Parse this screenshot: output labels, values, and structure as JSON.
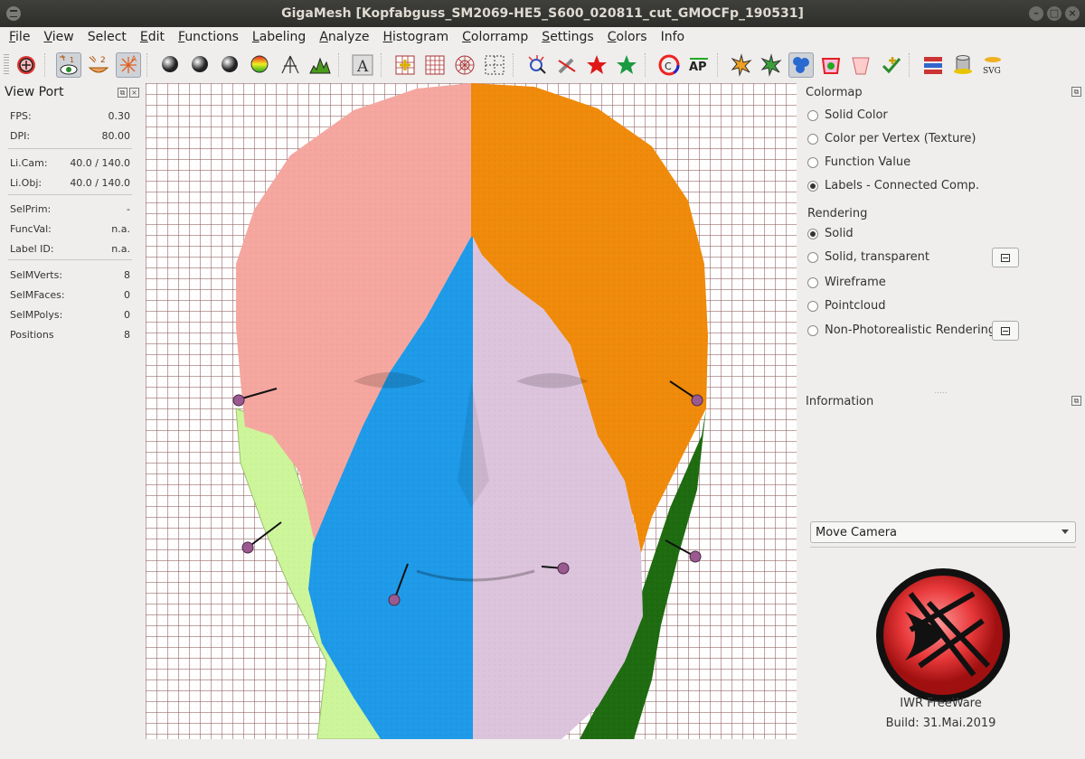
{
  "window": {
    "title": "GigaMesh [Kopfabguss_SM2069-HE5_S600_020811_cut_GMOCFp_190531]"
  },
  "menu": [
    {
      "label": "File",
      "mn": "F",
      "rest": "ile"
    },
    {
      "label": "View",
      "mn": "V",
      "rest": "iew"
    },
    {
      "label": "Select",
      "mn": "",
      "rest": "Select"
    },
    {
      "label": "Edit",
      "mn": "E",
      "rest": "dit"
    },
    {
      "label": "Functions",
      "mn": "F",
      "rest": "unctions"
    },
    {
      "label": "Labeling",
      "mn": "L",
      "rest": "abeling"
    },
    {
      "label": "Analyze",
      "mn": "A",
      "rest": "nalyze"
    },
    {
      "label": "Histogram",
      "mn": "H",
      "rest": "istogram"
    },
    {
      "label": "Colorramp",
      "mn": "C",
      "rest": "olorramp"
    },
    {
      "label": "Settings",
      "mn": "S",
      "rest": "ettings"
    },
    {
      "label": "Colors",
      "mn": "C",
      "rest": "olors"
    },
    {
      "label": "Info",
      "mn": "",
      "rest": "Info"
    }
  ],
  "toolbar": {
    "icons": [
      "gigamesh-logo-icon",
      "show-eye-icon",
      "show-ui-icon",
      "axes-icon",
      "sphere-m-icon",
      "sphere-d-icon",
      "sphere-s-icon",
      "sphere-a-icon",
      "light-icon",
      "histogram-icon",
      "font-icon",
      "grid-add-icon",
      "grid-icon",
      "polar-grid-icon",
      "select-grid-icon",
      "sparkle-icon",
      "no-pen-icon",
      "red-star-icon",
      "green-star-icon",
      "color-wheel-icon",
      "ap-icon",
      "burst-icon",
      "green-burst-icon",
      "blobs-icon",
      "red-stamp-icon",
      "bucket-icon",
      "check-plus-icon",
      "layers-icon",
      "cylinder-icon",
      "svg-icon"
    ],
    "svg_label": "SVG",
    "ap_label": "AP"
  },
  "viewport_panel": {
    "title": "View Port",
    "rows": [
      {
        "label": "FPS:",
        "value": "0.30"
      },
      {
        "label": "DPI:",
        "value": "80.00"
      },
      {
        "label": "Li.Cam:",
        "value": "40.0 / 140.0"
      },
      {
        "label": "Li.Obj:",
        "value": "40.0 / 140.0"
      },
      {
        "label": "SelPrim:",
        "value": "-"
      },
      {
        "label": "FuncVal:",
        "value": "n.a."
      },
      {
        "label": "Label ID:",
        "value": "n.a."
      },
      {
        "label": "SelMVerts:",
        "value": "8"
      },
      {
        "label": "SelMFaces:",
        "value": "0"
      },
      {
        "label": "SelMPolys:",
        "value": "0"
      },
      {
        "label": "Positions",
        "value": "8"
      }
    ]
  },
  "colormap": {
    "title": "Colormap",
    "options": [
      "Solid Color",
      "Color per Vertex (Texture)",
      "Function Value",
      "Labels - Connected Comp."
    ],
    "selected": "Labels - Connected Comp."
  },
  "rendering": {
    "title": "Rendering",
    "options": [
      "Solid",
      "Solid, transparent",
      "Wireframe",
      "Pointcloud",
      "Non-Photorealistic Rendering"
    ],
    "selected": "Solid"
  },
  "information": {
    "title": "Information"
  },
  "mode_select": {
    "value": "Move Camera"
  },
  "branding": {
    "line1": "IWR FreeWare",
    "line2": "Build: 31.Mai.2019"
  },
  "colors": {
    "label_pink": "#f5a79f",
    "label_orange": "#f08a0a",
    "label_blue": "#1e9ae8",
    "label_lilac": "#dcc4dc",
    "label_lightgreen": "#cdf59a",
    "label_darkgreen": "#1e6b10",
    "logo_red": "#e8383a"
  }
}
